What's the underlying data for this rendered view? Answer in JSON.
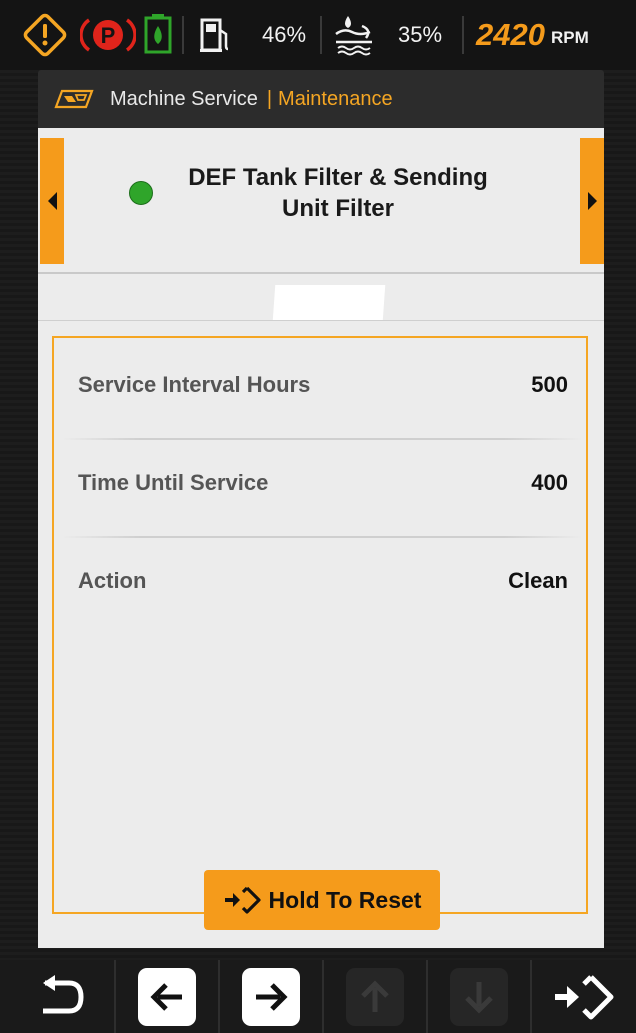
{
  "status_bar": {
    "warning_icon": "warning-diamond-icon",
    "parking_icon": "parking-brake-icon",
    "def_icon": "def-fluid-icon",
    "fuel_icon": "fuel-pump-icon",
    "fuel_percent": "46%",
    "def_level_icon": "def-level-icon",
    "def_percent": "35%",
    "rpm_value": "2420",
    "rpm_unit": "RPM"
  },
  "header": {
    "icon": "machine-icon",
    "title": "Machine Service",
    "separator": "|",
    "subtitle": "Maintenance"
  },
  "item": {
    "status_color": "#2fa52a",
    "title_line1": "DEF Tank Filter & Sending",
    "title_line2": "Unit Filter"
  },
  "details": [
    {
      "label": "Service Interval Hours",
      "value": "500"
    },
    {
      "label": "Time Until Service",
      "value": "400"
    },
    {
      "label": "Action",
      "value": "Clean"
    }
  ],
  "reset_button": {
    "label": "Hold To Reset",
    "icon": "enter-arrow-icon"
  },
  "toolbar": {
    "back": "back-return-icon",
    "left": "arrow-left-icon",
    "right": "arrow-right-icon",
    "up": "arrow-up-icon",
    "down": "arrow-down-icon",
    "enter": "enter-arrow-icon"
  },
  "colors": {
    "accent": "#f59b1b",
    "warning": "#f5a623",
    "parking": "#e0241b",
    "def_green": "#2fa52a"
  }
}
